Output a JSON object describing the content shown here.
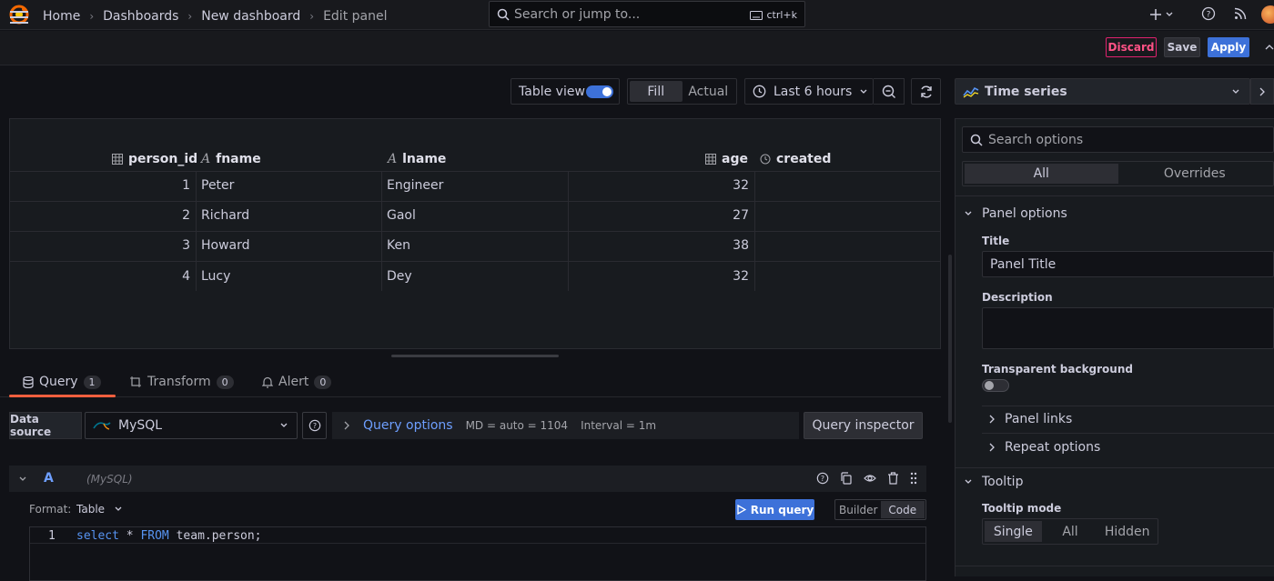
{
  "topbar": {
    "search_placeholder": "Search or jump to...",
    "search_shortcut": "ctrl+k"
  },
  "breadcrumbs": [
    "Home",
    "Dashboards",
    "New dashboard",
    "Edit panel"
  ],
  "actions": {
    "discard": "Discard",
    "save": "Save",
    "apply": "Apply"
  },
  "toolbar": {
    "table_view_label": "Table view",
    "table_view_on": true,
    "fill": "Fill",
    "actual": "Actual",
    "time_range": "Last 6 hours"
  },
  "table": {
    "columns": [
      {
        "name": "person_id",
        "icon": "number-icon"
      },
      {
        "name": "fname",
        "icon": "text-icon"
      },
      {
        "name": "lname",
        "icon": "text-icon"
      },
      {
        "name": "age",
        "icon": "number-icon"
      },
      {
        "name": "created",
        "icon": "clock-icon"
      }
    ],
    "rows": [
      {
        "person_id": "1",
        "fname": "Peter",
        "lname": "Engineer",
        "age": "32",
        "created": ""
      },
      {
        "person_id": "2",
        "fname": "Richard",
        "lname": "Gaol",
        "age": "27",
        "created": ""
      },
      {
        "person_id": "3",
        "fname": "Howard",
        "lname": "Ken",
        "age": "38",
        "created": ""
      },
      {
        "person_id": "4",
        "fname": "Lucy",
        "lname": "Dey",
        "age": "32",
        "created": ""
      }
    ]
  },
  "query_tabs": [
    {
      "label": "Query",
      "count": "1"
    },
    {
      "label": "Transform",
      "count": "0"
    },
    {
      "label": "Alert",
      "count": "0"
    }
  ],
  "datasource": {
    "label": "Data source",
    "value": "MySQL",
    "query_options": "Query options",
    "md": "MD = auto = 1104",
    "interval": "Interval = 1m",
    "inspector": "Query inspector"
  },
  "query": {
    "ref": "A",
    "ds_name": "(MySQL)",
    "format_label": "Format:",
    "format_value": "Table",
    "run": "Run query",
    "builder": "Builder",
    "code": "Code",
    "line_number": "1",
    "sql": {
      "kw1": "select",
      "star": " * ",
      "kw2": "FROM",
      "rest": " team.person;"
    }
  },
  "sidebar": {
    "viz": "Time series",
    "search_placeholder": "Search options",
    "tab_all": "All",
    "tab_overrides": "Overrides",
    "panel_options": "Panel options",
    "title_label": "Title",
    "title_value": "Panel Title",
    "description_label": "Description",
    "transparent_label": "Transparent background",
    "transparent_on": false,
    "panel_links": "Panel links",
    "repeat_options": "Repeat options",
    "tooltip": "Tooltip",
    "tooltip_mode_label": "Tooltip mode",
    "tooltip_modes": [
      "Single",
      "All",
      "Hidden"
    ],
    "tooltip_mode_selected": "Single"
  },
  "colors": {
    "accent": "#3d71d9",
    "discard": "#e0226e",
    "tab_active": "#f55f3e",
    "link": "#6e9fff"
  }
}
